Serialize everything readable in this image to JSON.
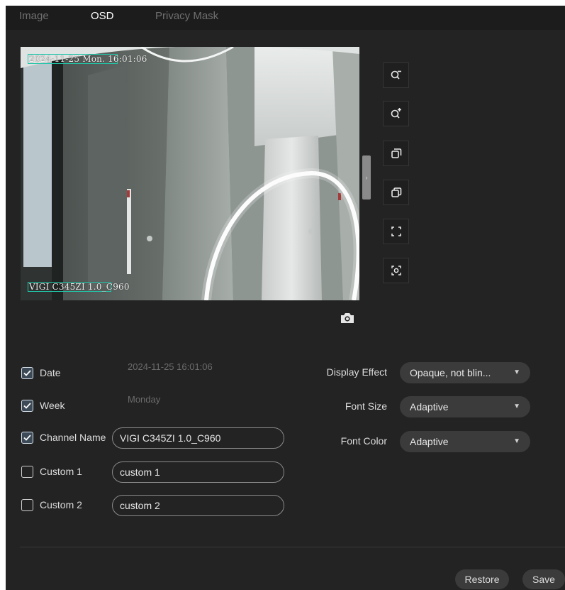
{
  "tabs": [
    {
      "label": "Image"
    },
    {
      "label": "OSD"
    },
    {
      "label": "Privacy Mask"
    }
  ],
  "preview": {
    "date_overlay": "2024-11-25 Mon. 16:01:06",
    "channel_overlay": "VIGI C345ZI 1.0_C960"
  },
  "toolbar": {
    "icons": [
      "zoom-out-icon",
      "zoom-in-icon",
      "window-front-icon",
      "window-back-icon",
      "fullscreen-icon",
      "focus-icon"
    ]
  },
  "snapshot_icon": "camera-icon",
  "osd": {
    "date": {
      "label": "Date",
      "checked": true,
      "value": "2024-11-25 16:01:06"
    },
    "week": {
      "label": "Week",
      "checked": true,
      "value": "Monday"
    },
    "channel": {
      "label": "Channel Name",
      "checked": true,
      "value": "VIGI C345ZI 1.0_C960"
    },
    "custom1": {
      "label": "Custom 1",
      "checked": false,
      "value": "custom 1"
    },
    "custom2": {
      "label": "Custom 2",
      "checked": false,
      "value": "custom 2"
    }
  },
  "settings": {
    "display_effect": {
      "label": "Display Effect",
      "value": "Opaque, not blin..."
    },
    "font_size": {
      "label": "Font Size",
      "value": "Adaptive"
    },
    "font_color": {
      "label": "Font Color",
      "value": "Adaptive"
    }
  },
  "buttons": {
    "restore": "Restore",
    "save": "Save"
  },
  "colors": {
    "background": "#232323",
    "osd_border": "#21c5a8",
    "checkbox_checked": "#3c4a57"
  }
}
